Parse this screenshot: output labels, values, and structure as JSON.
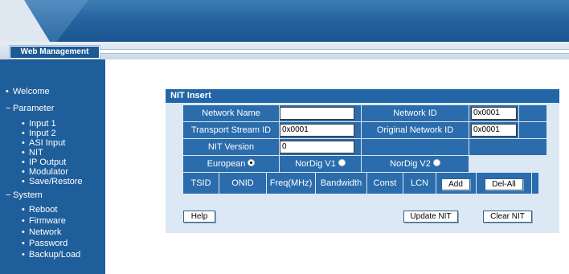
{
  "header": {
    "tab_label": "Web Management"
  },
  "sidebar": {
    "welcome": "Welcome",
    "parameter": "Parameter",
    "parameter_items": [
      "Input 1",
      "Input 2",
      "ASI Input",
      "NIT",
      "IP Output",
      "Modulator",
      "Save/Restore"
    ],
    "system": "System",
    "system_items": [
      "Reboot",
      "Firmware",
      "Network",
      "Password",
      "Backup/Load"
    ]
  },
  "panel": {
    "title": "NIT Insert",
    "network_name_label": "Network Name",
    "network_name_value": "",
    "network_id_label": "Network ID",
    "network_id_value": "0x0001",
    "transport_stream_id_label": "Transport Stream ID",
    "transport_stream_id_value": "0x0001",
    "original_network_id_label": "Original Network ID",
    "original_network_id_value": "0x0001",
    "nit_version_label": "NIT Version",
    "nit_version_value": "0",
    "modes": [
      "European",
      "NorDig V1",
      "NorDig V2"
    ],
    "selected_mode": "European",
    "columns": [
      "TSID",
      "ONID",
      "Freq(MHz)",
      "Bandwidth",
      "Const",
      "LCN"
    ],
    "add_button": "Add",
    "del_all_button": "Del-All",
    "help_button": "Help",
    "update_button": "Update NIT",
    "clear_button": "Clear NIT"
  }
}
